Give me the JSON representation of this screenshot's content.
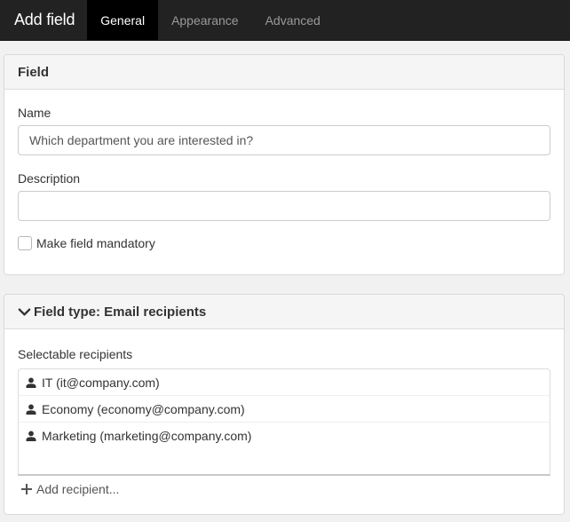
{
  "header": {
    "title": "Add field",
    "tabs": [
      {
        "label": "General",
        "active": true
      },
      {
        "label": "Appearance",
        "active": false
      },
      {
        "label": "Advanced",
        "active": false
      }
    ]
  },
  "field_panel": {
    "heading": "Field",
    "name_label": "Name",
    "name_value": "Which department you are interested in?",
    "description_label": "Description",
    "description_value": "",
    "mandatory_label": "Make field mandatory",
    "mandatory_checked": false
  },
  "type_panel": {
    "heading": "Field type: Email recipients",
    "recipients_label": "Selectable recipients",
    "recipients": [
      {
        "label": "IT (it@company.com)",
        "icon": "person-icon"
      },
      {
        "label": "Economy (economy@company.com)",
        "icon": "person-icon"
      },
      {
        "label": "Marketing (marketing@company.com)",
        "icon": "person-icon"
      }
    ],
    "add_label": "Add recipient..."
  },
  "colors": {
    "topbar": "#222222",
    "active_tab": "#000000",
    "background": "#f1f1f1"
  }
}
